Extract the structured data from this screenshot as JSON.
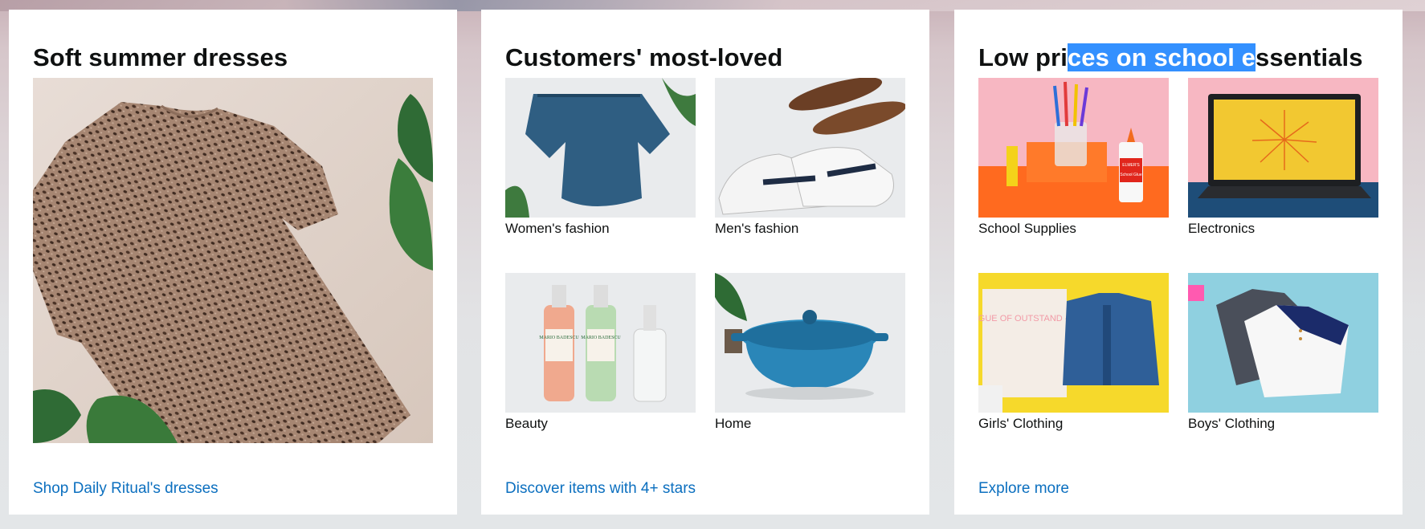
{
  "cards": [
    {
      "title": "Soft summer dresses",
      "link": "Shop Daily Ritual's dresses"
    },
    {
      "title": "Customers' most-loved",
      "tiles": [
        {
          "caption": "Women's fashion"
        },
        {
          "caption": "Men's fashion"
        },
        {
          "caption": "Beauty"
        },
        {
          "caption": "Home"
        }
      ],
      "link": "Discover items with 4+ stars"
    },
    {
      "title_parts": {
        "before": "Low pri",
        "selected": "ces on school e",
        "after": "ssentials"
      },
      "tiles": [
        {
          "caption": "School Supplies"
        },
        {
          "caption": "Electronics"
        },
        {
          "caption": "Girls' Clothing"
        },
        {
          "caption": "Boys' Clothing"
        }
      ],
      "link": "Explore more"
    }
  ],
  "image_text": {
    "mario_badescu": "MARIO BADESCU",
    "elmers": "ELMER'S",
    "school_glue": "School Glue",
    "league": "LEAGUE OF OUTSTAND -ING"
  },
  "colors": {
    "link": "#0b6fbf",
    "selection": "#3390ff",
    "title": "#0f1111"
  }
}
